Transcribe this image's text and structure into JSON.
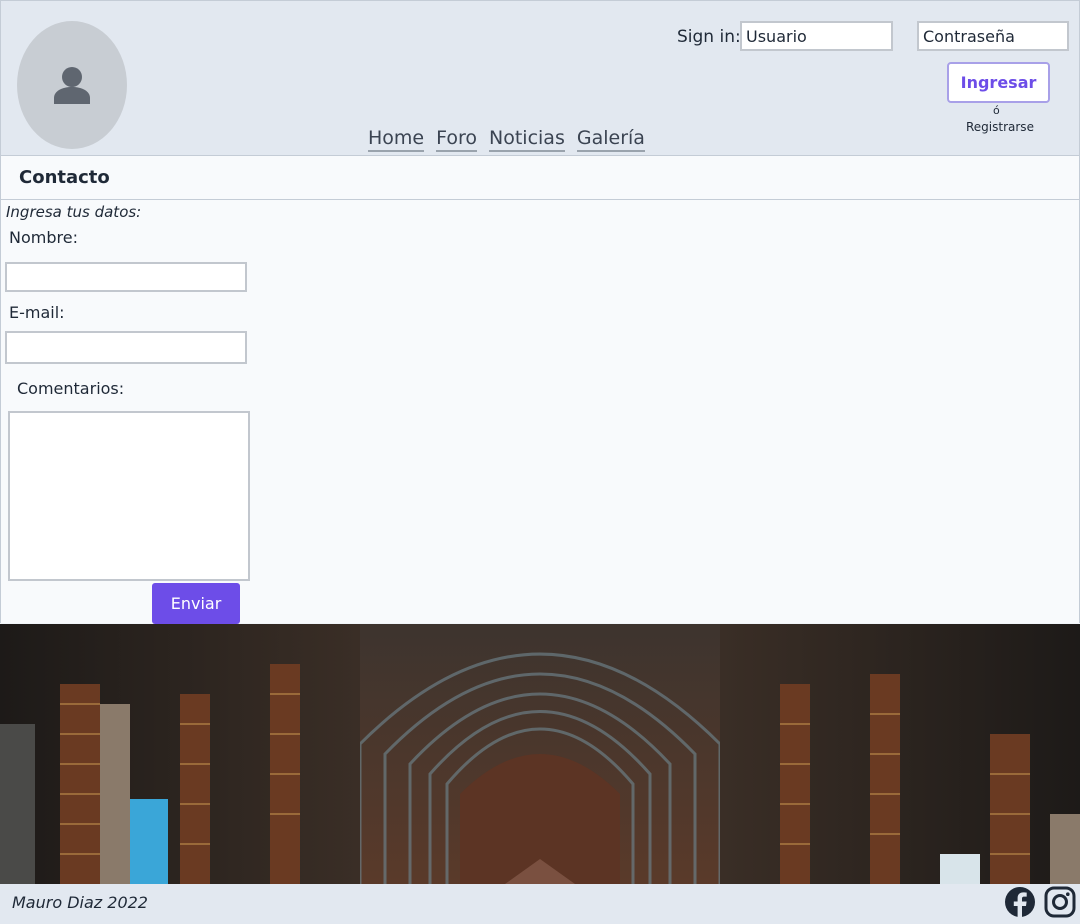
{
  "header": {
    "avatar_icon": "user-icon",
    "nav": [
      "Home",
      "Foro",
      "Noticias",
      "Galería"
    ],
    "signin_label": "Sign in:",
    "username_value": "Usuario",
    "password_value": "Contraseña",
    "login_button": "Ingresar",
    "or_text": "ó",
    "register_link": "Registrarse"
  },
  "page": {
    "title": "Contacto"
  },
  "form": {
    "intro": "Ingresa tus datos:",
    "name_label": "Nombre:",
    "name_value": "",
    "email_label": "E-mail:",
    "email_value": "",
    "comments_label": "Comentarios:",
    "comments_value": "",
    "submit_label": "Enviar"
  },
  "banner": {
    "image": "library-hall-photo"
  },
  "footer": {
    "text": "Mauro Diaz 2022",
    "icons": [
      "facebook-icon",
      "instagram-icon"
    ]
  },
  "colors": {
    "accent": "#6d4de8",
    "header_bg": "#e2e8f0",
    "content_bg": "#f8fafc"
  }
}
